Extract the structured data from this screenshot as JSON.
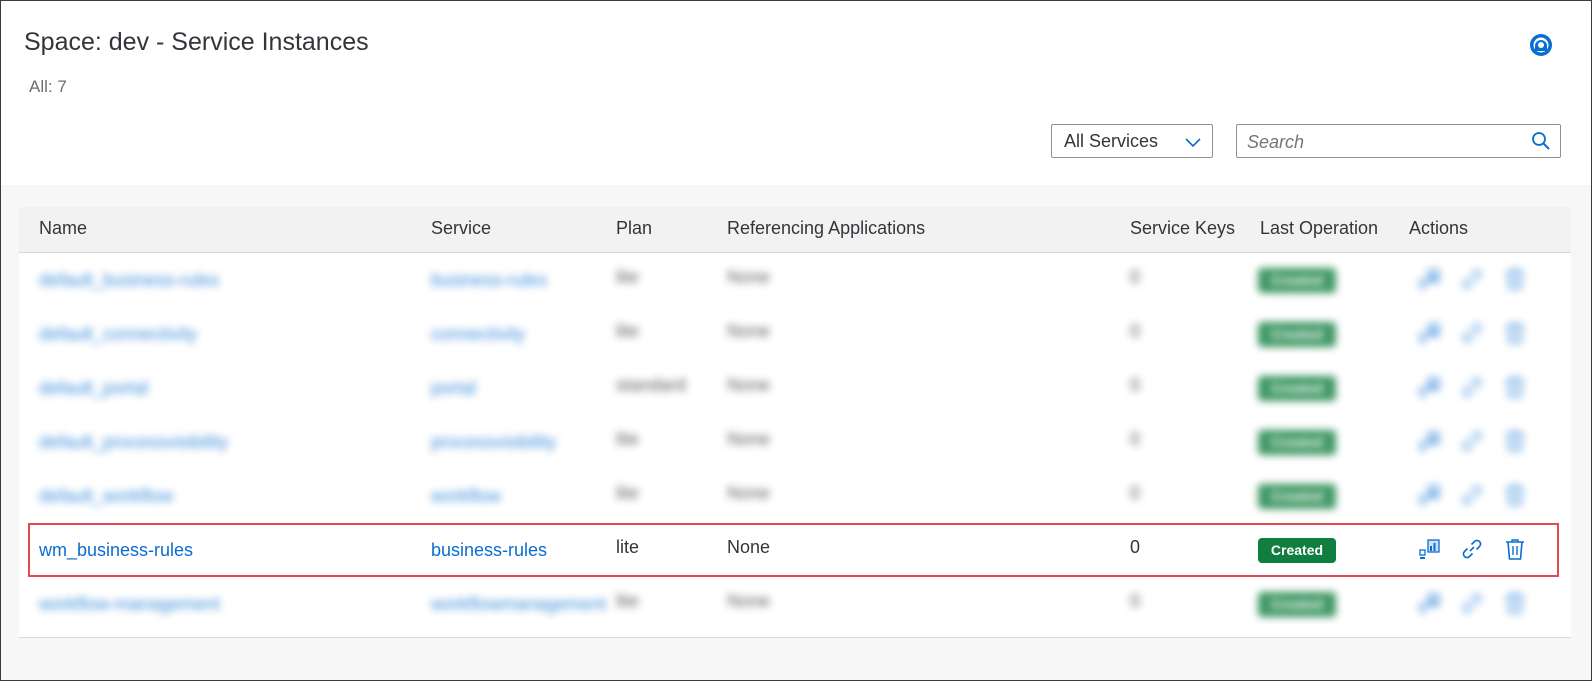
{
  "header": {
    "title": "Space: dev - Service Instances",
    "count_label": "All: 7"
  },
  "filter": {
    "selected": "All Services"
  },
  "search": {
    "placeholder": "Search",
    "value": ""
  },
  "table": {
    "columns": [
      "Name",
      "Service",
      "Plan",
      "Referencing Applications",
      "Service Keys",
      "Last Operation",
      "Actions"
    ],
    "rows": [
      {
        "name": "default_business-rules",
        "service": "business-rules",
        "plan": "lite",
        "apps": "None",
        "keys": "0",
        "status": "Created",
        "blurred": true
      },
      {
        "name": "default_connectivity",
        "service": "connectivity",
        "plan": "lite",
        "apps": "None",
        "keys": "0",
        "status": "Created",
        "blurred": true
      },
      {
        "name": "default_portal",
        "service": "portal",
        "plan": "standard",
        "apps": "None",
        "keys": "0",
        "status": "Created",
        "blurred": true
      },
      {
        "name": "default_processvisibility",
        "service": "processvisibility",
        "plan": "lite",
        "apps": "None",
        "keys": "0",
        "status": "Created",
        "blurred": true
      },
      {
        "name": "default_workflow",
        "service": "workflow",
        "plan": "lite",
        "apps": "None",
        "keys": "0",
        "status": "Created",
        "blurred": true
      },
      {
        "name": "wm_business-rules",
        "service": "business-rules",
        "plan": "lite",
        "apps": "None",
        "keys": "0",
        "status": "Created",
        "blurred": false
      },
      {
        "name": "workflow-management",
        "service": "workflowmanagement",
        "plan": "lite",
        "apps": "None",
        "keys": "0",
        "status": "Created",
        "blurred": true
      }
    ]
  },
  "icons": {
    "help": "help-circle-icon",
    "dropdown": "chevron-down-icon",
    "search": "search-icon",
    "dashboard": "dashboard-icon",
    "bind": "link-icon",
    "delete": "trash-icon"
  },
  "colors": {
    "link": "#0a6ed1",
    "success": "#107e3e",
    "highlight": "#e04a52"
  }
}
